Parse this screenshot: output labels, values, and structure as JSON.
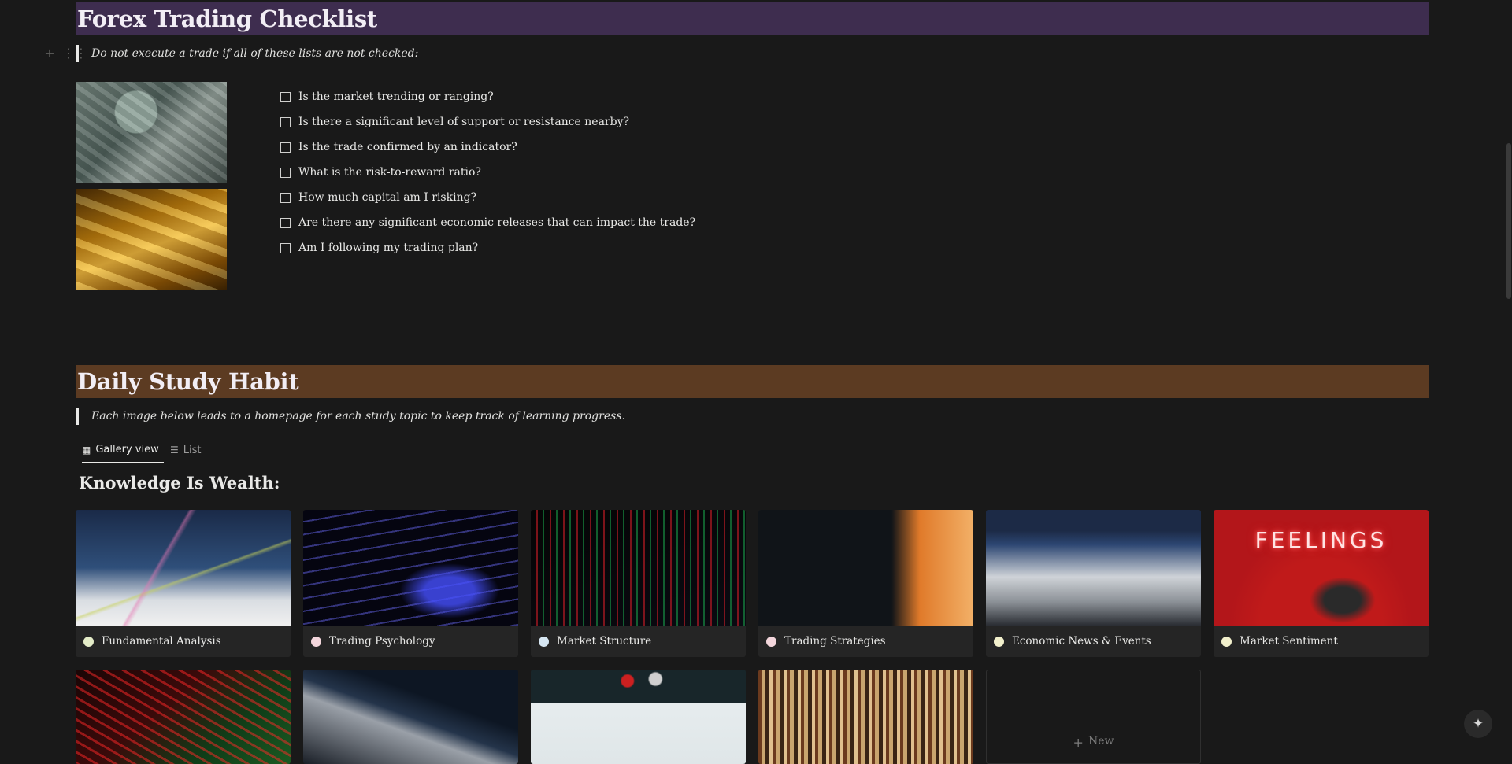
{
  "checklist_section": {
    "title": "Forex Trading Checklist",
    "quote": "Do not execute a trade if all of these lists are not checked:",
    "items": [
      {
        "label": "Is the market trending or ranging?",
        "checked": false
      },
      {
        "label": "Is there a significant level of support or resistance nearby?",
        "checked": false
      },
      {
        "label": "Is the trade confirmed by an indicator?",
        "checked": false
      },
      {
        "label": "What is the risk-to-reward ratio?",
        "checked": false
      },
      {
        "label": "How much capital am I risking?",
        "checked": false
      },
      {
        "label": "Are there any significant economic releases that can impact the trade?",
        "checked": false
      },
      {
        "label": "Am I following my trading plan?",
        "checked": false
      }
    ],
    "heading_color": "#3e2d4f"
  },
  "study_section": {
    "title": "Daily Study Habit",
    "quote": "Each image below leads to a homepage for each study topic to keep track of learning progress.",
    "heading_color": "#5c3b22",
    "tabs": [
      {
        "label": "Gallery view",
        "icon": "gallery-grid-icon",
        "active": true
      },
      {
        "label": "List",
        "icon": "list-icon",
        "active": false
      }
    ],
    "gallery_title": "Knowledge Is Wealth:",
    "cards": [
      {
        "label": "Fundamental Analysis",
        "dot_color": "#e4ecc8"
      },
      {
        "label": "Trading Psychology",
        "dot_color": "#f3d6dc"
      },
      {
        "label": "Market Structure",
        "dot_color": "#d6e6f2"
      },
      {
        "label": "Trading Strategies",
        "dot_color": "#f3d6dc"
      },
      {
        "label": "Economic News & Events",
        "dot_color": "#f2f0cc"
      },
      {
        "label": "Market Sentiment",
        "dot_color": "#f2f0cc"
      }
    ],
    "cover_neon_text": "FEELINGS",
    "new_label": "New"
  }
}
